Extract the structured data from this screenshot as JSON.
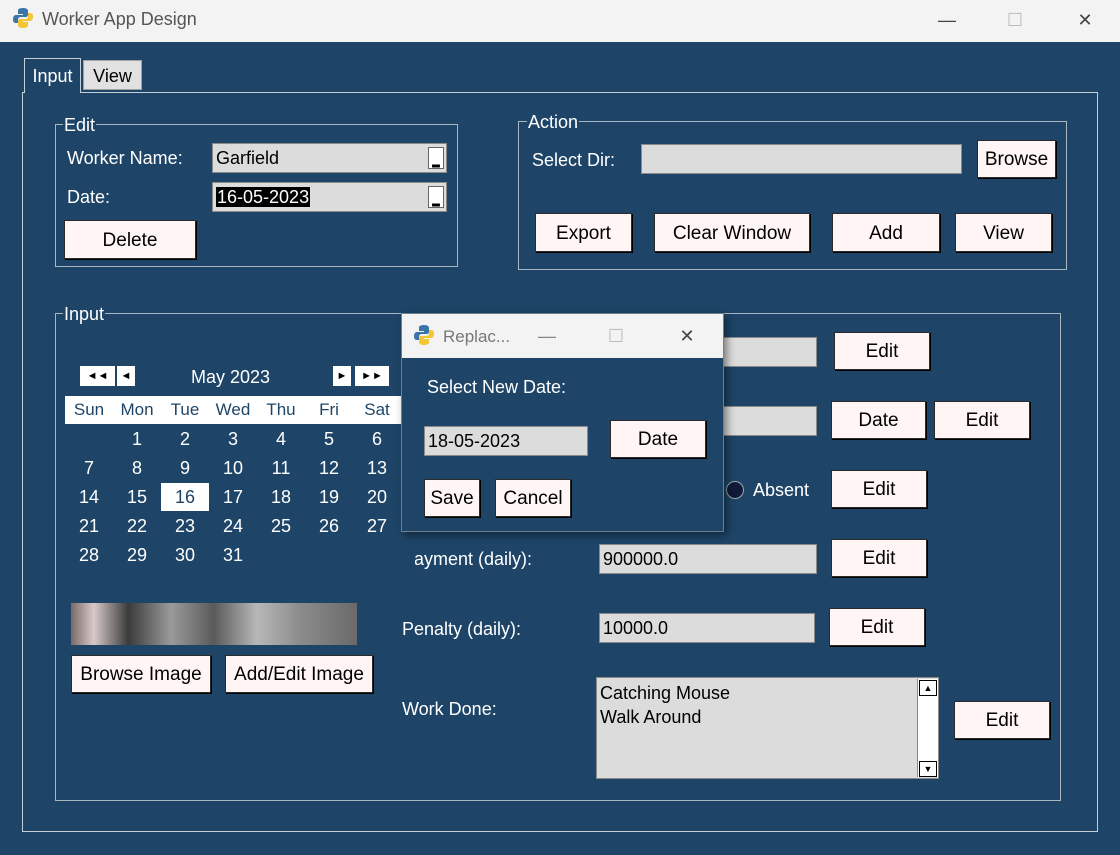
{
  "window": {
    "title": "Worker App Design",
    "minimize": "—",
    "maximize": "☐",
    "close": "✕"
  },
  "tabs": [
    {
      "label": "Input"
    },
    {
      "label": "View"
    }
  ],
  "edit": {
    "legend": "Edit",
    "worker_name_label": "Worker Name:",
    "worker_name_value": "Garfield",
    "date_label": "Date:",
    "date_value": "16-05-2023",
    "delete_label": "Delete"
  },
  "action": {
    "legend": "Action",
    "select_dir_label": "Select Dir:",
    "select_dir_value": "",
    "browse_label": "Browse",
    "export_label": "Export",
    "clear_label": "Clear Window",
    "add_label": "Add",
    "view_label": "View"
  },
  "input": {
    "legend": "Input",
    "calendar": {
      "month_label": "May 2023",
      "prev_year": "◄◄",
      "prev_month": "◄",
      "next_month": "►",
      "next_year": "►►",
      "weekdays": [
        "Sun",
        "Mon",
        "Tue",
        "Wed",
        "Thu",
        "Fri",
        "Sat"
      ],
      "weeks": [
        [
          "",
          "1",
          "2",
          "3",
          "4",
          "5",
          "6"
        ],
        [
          "7",
          "8",
          "9",
          "10",
          "11",
          "12",
          "13"
        ],
        [
          "14",
          "15",
          "16",
          "17",
          "18",
          "19",
          "20"
        ],
        [
          "21",
          "22",
          "23",
          "24",
          "25",
          "26",
          "27"
        ],
        [
          "28",
          "29",
          "30",
          "31",
          "",
          "",
          ""
        ]
      ],
      "selected_day": "16"
    },
    "browse_image_label": "Browse Image",
    "add_edit_image_label": "Add/Edit Image",
    "absent_label": "Absent",
    "payment_label": "Payment (daily):",
    "payment_value": "900000.0",
    "penalty_label": "Penalty (daily):",
    "penalty_value": "10000.0",
    "work_done_label": "Work Done:",
    "work_done_value": "Catching Mouse\nWalk Around",
    "edit_label": "Edit",
    "date_button_label": "Date"
  },
  "dialog": {
    "title": "Replac...",
    "prompt": "Select New Date:",
    "date_value": "18-05-2023",
    "date_button": "Date",
    "save_label": "Save",
    "cancel_label": "Cancel"
  }
}
